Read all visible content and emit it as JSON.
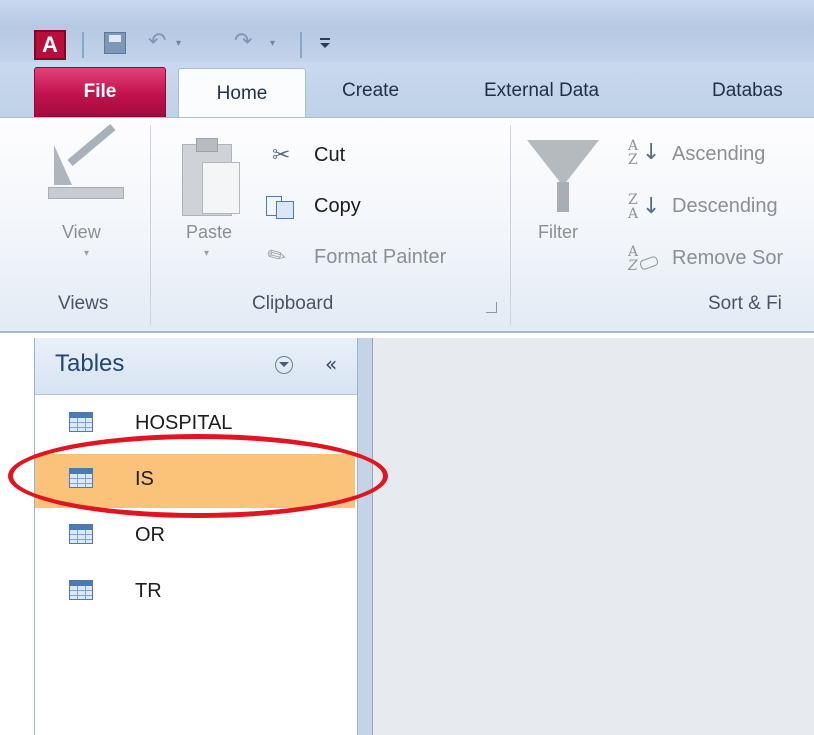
{
  "quick_access": {
    "app_icon_label": "A",
    "save_icon": "save-icon",
    "undo_icon": "undo-icon",
    "redo_icon": "redo-icon",
    "undo_glyph": "↶",
    "redo_glyph": "↷",
    "dropdown_glyph": "▾"
  },
  "tabs": {
    "file": "File",
    "home": "Home",
    "create": "Create",
    "external_data": "External Data",
    "database": "Databas"
  },
  "ribbon": {
    "views": {
      "view_label": "View",
      "group_label": "Views",
      "dropdown_glyph": "▾"
    },
    "clipboard": {
      "paste_label": "Paste",
      "cut_label": "Cut",
      "copy_label": "Copy",
      "format_painter_label": "Format Painter",
      "group_label": "Clipboard",
      "scissors_glyph": "✂",
      "brush_glyph": "✎",
      "dropdown_glyph": "▾"
    },
    "sort_filter": {
      "filter_label": "Filter",
      "ascending_label": "Ascending",
      "descending_label": "Descending",
      "remove_sort_label": "Remove Sor",
      "group_label": "Sort & Fi",
      "a_letter": "A",
      "z_letter": "Z",
      "arrow_glyph": "↓"
    }
  },
  "navigation_pane": {
    "title": "Tables",
    "collapse_glyph": "«",
    "items": [
      {
        "label": "HOSPITAL",
        "selected": false
      },
      {
        "label": "IS",
        "selected": true
      },
      {
        "label": "OR",
        "selected": false
      },
      {
        "label": "TR",
        "selected": false
      }
    ]
  },
  "colors": {
    "file_tab": "#c2124e",
    "selection": "#fbc37a",
    "annotation": "#e1141f"
  }
}
